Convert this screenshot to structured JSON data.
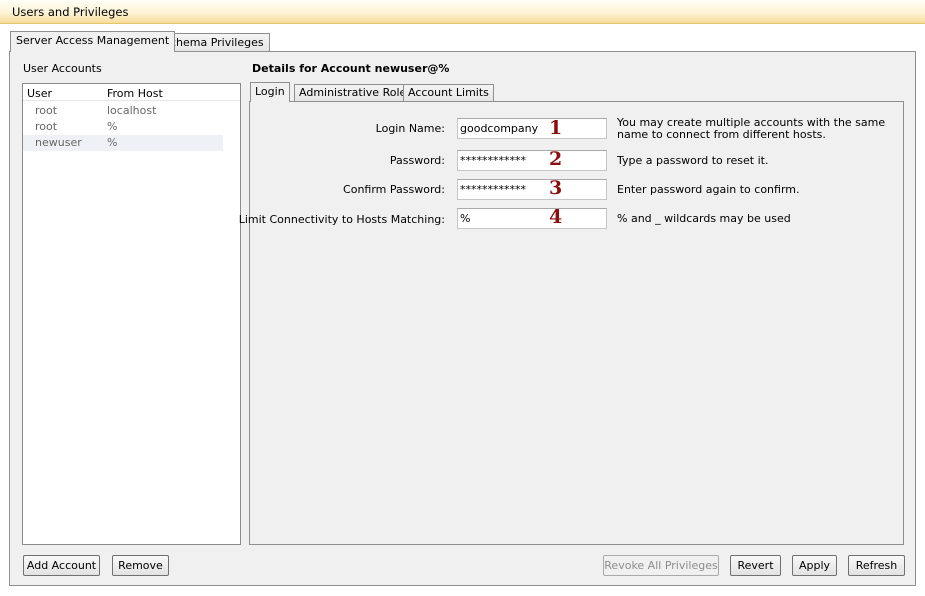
{
  "window": {
    "title": "Users and Privileges"
  },
  "outer_tabs": [
    "Server Access Management",
    "Schema Privileges"
  ],
  "user_accounts": {
    "title": "User Accounts",
    "columns": [
      "User",
      "From Host"
    ],
    "rows": [
      {
        "user": "root",
        "host": "localhost"
      },
      {
        "user": "root",
        "host": "%"
      },
      {
        "user": "newuser",
        "host": "%"
      }
    ]
  },
  "details": {
    "title": "Details for Account newuser@%",
    "tabs": [
      "Login",
      "Administrative Roles",
      "Account Limits"
    ],
    "fields": [
      {
        "label": "Login Name:",
        "value": "goodcompany",
        "marker": "1",
        "help": "You may create multiple accounts with the same name to connect from different hosts."
      },
      {
        "label": "Password:",
        "value": "************",
        "marker": "2",
        "help": "Type a password to reset it."
      },
      {
        "label": "Confirm Password:",
        "value": "************",
        "marker": "3",
        "help": "Enter password again to confirm."
      },
      {
        "label": "Limit Connectivity to Hosts Matching:",
        "value": "%",
        "marker": "4",
        "help": "% and _ wildcards may be used"
      }
    ]
  },
  "buttons": {
    "add_account": "Add Account",
    "remove": "Remove",
    "revoke_all": "Revoke All Privileges",
    "revert": "Revert",
    "apply": "Apply",
    "refresh": "Refresh"
  }
}
